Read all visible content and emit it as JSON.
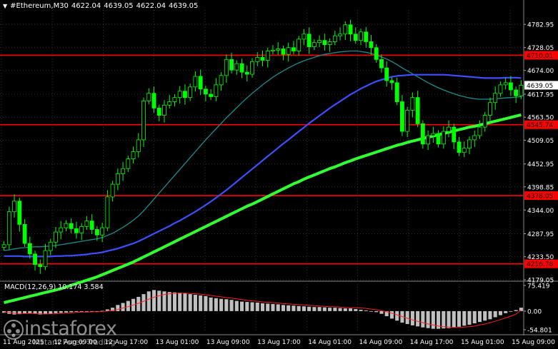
{
  "header": {
    "symbol": "#Ethereum,M30",
    "open": "4622.04",
    "high": "4639.05",
    "low": "4622.04",
    "close": "4639.05"
  },
  "watermark": {
    "brand": "instaforex",
    "tagline": "Instant Forex Trading"
  },
  "colors": {
    "background": "#000000",
    "grid": "#333333",
    "candles": "#00ff00",
    "level_lines": "#ff0000",
    "level_label_bg": "#ff0000",
    "ma_fast": "#1e8c8c",
    "ma_mid": "#3c50ff",
    "ma_slow": "#32ff32",
    "macd_hist": "#c0c0c0",
    "macd_signal": "#ff2020",
    "axis_text": "#ffffff"
  },
  "chart_data": [
    {
      "type": "candlestick",
      "title": "#Ethereum,M30",
      "ylim": [
        4179.05,
        4817.0
      ],
      "y_ticks": [
        "4782.95",
        "4728.05",
        "4674.00",
        "4617.95",
        "4563.50",
        "4509.05",
        "4452.95",
        "4398.85",
        "4344.00",
        "4287.95",
        "4233.50",
        "4179.05"
      ],
      "current_price": "4639.05",
      "x_tick_labels": [
        "11 Aug 2025",
        "12 Aug 09:00",
        "12 Aug 17:00",
        "13 Aug 01:00",
        "13 Aug 09:00",
        "13 Aug 17:00",
        "14 Aug 01:00",
        "14 Aug 09:00",
        "14 Aug 17:00",
        "15 Aug 01:00",
        "15 Aug 09:00"
      ],
      "levels": [
        {
          "value": 4710.01,
          "label": "4710.01"
        },
        {
          "value": 4545.74,
          "label": "4545.74"
        },
        {
          "value": 4378.05,
          "label": "4378.05"
        },
        {
          "value": 4216.78,
          "label": "4216.78"
        }
      ],
      "series": [
        {
          "role": "close",
          "color": "#00ff00",
          "values": [
            4262,
            4340,
            4365,
            4310,
            4265,
            4240,
            4215,
            4210,
            4248,
            4268,
            4292,
            4302,
            4312,
            4300,
            4290,
            4305,
            4318,
            4298,
            4285,
            4302,
            4375,
            4405,
            4430,
            4442,
            4465,
            4482,
            4510,
            4602,
            4620,
            4585,
            4568,
            4592,
            4600,
            4610,
            4625,
            4610,
            4635,
            4660,
            4630,
            4618,
            4612,
            4640,
            4662,
            4700,
            4675,
            4690,
            4670,
            4665,
            4695,
            4705,
            4698,
            4720,
            4722,
            4725,
            4712,
            4728,
            4720,
            4748,
            4760,
            4730,
            4740,
            4745,
            4735,
            4742,
            4756,
            4760,
            4782,
            4760,
            4745,
            4765,
            4742,
            4728,
            4700,
            4680,
            4650,
            4645,
            4600,
            4530,
            4580,
            4610,
            4548,
            4500,
            4520,
            4525,
            4500,
            4530,
            4540,
            4505,
            4480,
            4490,
            4510,
            4520,
            4540,
            4568,
            4598,
            4620,
            4640,
            4645,
            4628,
            4614,
            4639
          ]
        },
        {
          "role": "ma",
          "color": "#1e8c8c",
          "values": [
            4248,
            4250,
            4252,
            4254,
            4255,
            4256,
            4257,
            4257,
            4258,
            4259,
            4260,
            4262,
            4264,
            4266,
            4268,
            4270,
            4272,
            4274,
            4276,
            4279,
            4284,
            4289,
            4296,
            4303,
            4311,
            4320,
            4330,
            4342,
            4356,
            4370,
            4384,
            4398,
            4412,
            4426,
            4440,
            4454,
            4468,
            4482,
            4496,
            4510,
            4523,
            4536,
            4549,
            4562,
            4574,
            4586,
            4598,
            4609,
            4620,
            4630,
            4640,
            4649,
            4658,
            4666,
            4673,
            4680,
            4686,
            4692,
            4697,
            4701,
            4705,
            4709,
            4712,
            4714,
            4716,
            4718,
            4719,
            4720,
            4720,
            4719,
            4717,
            4714,
            4710,
            4706,
            4701,
            4695,
            4688,
            4680,
            4673,
            4666,
            4659,
            4652,
            4645,
            4639,
            4633,
            4628,
            4623,
            4619,
            4615,
            4612,
            4609,
            4607,
            4606,
            4606,
            4606,
            4607,
            4608,
            4609,
            4610,
            4611,
            4612
          ]
        },
        {
          "role": "ma",
          "color": "#3c50ff",
          "values": [
            4235,
            4235,
            4235,
            4235,
            4234,
            4234,
            4234,
            4234,
            4234,
            4234,
            4235,
            4235,
            4236,
            4236,
            4237,
            4238,
            4239,
            4241,
            4242,
            4244,
            4247,
            4250,
            4253,
            4257,
            4261,
            4265,
            4270,
            4276,
            4282,
            4288,
            4294,
            4300,
            4306,
            4313,
            4319,
            4326,
            4333,
            4340,
            4348,
            4356,
            4364,
            4373,
            4382,
            4391,
            4401,
            4411,
            4421,
            4431,
            4441,
            4451,
            4461,
            4471,
            4481,
            4491,
            4501,
            4510,
            4520,
            4530,
            4539,
            4549,
            4558,
            4567,
            4576,
            4585,
            4593,
            4601,
            4609,
            4617,
            4624,
            4631,
            4637,
            4643,
            4648,
            4652,
            4656,
            4659,
            4661,
            4662,
            4663,
            4664,
            4664,
            4664,
            4664,
            4664,
            4664,
            4664,
            4663,
            4662,
            4661,
            4660,
            4659,
            4658,
            4657,
            4656,
            4656,
            4656,
            4656,
            4657,
            4657,
            4657,
            4656
          ]
        },
        {
          "role": "ma",
          "color": "#32ff32",
          "values": [
            4125,
            4128,
            4131,
            4134,
            4137,
            4140,
            4143,
            4146,
            4149,
            4152,
            4155,
            4158,
            4162,
            4166,
            4170,
            4174,
            4178,
            4182,
            4186,
            4191,
            4196,
            4201,
            4206,
            4211,
            4216,
            4221,
            4227,
            4233,
            4239,
            4245,
            4251,
            4257,
            4263,
            4269,
            4275,
            4281,
            4287,
            4293,
            4299,
            4305,
            4311,
            4317,
            4323,
            4329,
            4335,
            4341,
            4347,
            4353,
            4358,
            4364,
            4370,
            4376,
            4382,
            4388,
            4394,
            4400,
            4406,
            4411,
            4417,
            4422,
            4427,
            4432,
            4437,
            4442,
            4446,
            4451,
            4456,
            4460,
            4465,
            4469,
            4473,
            4477,
            4481,
            4485,
            4489,
            4493,
            4497,
            4500,
            4504,
            4507,
            4510,
            4513,
            4516,
            4519,
            4522,
            4525,
            4528,
            4531,
            4534,
            4537,
            4540,
            4542,
            4545,
            4548,
            4551,
            4554,
            4557,
            4560,
            4563,
            4566,
            4569
          ]
        }
      ]
    },
    {
      "type": "bar",
      "title": "MACD(12,26,9) 10.174 3.584",
      "ylim": [
        -54.801,
        75.419
      ],
      "y_ticks": [
        "75.419",
        "0.00",
        "-54.801"
      ],
      "series": [
        {
          "name": "MACD",
          "color": "#c0c0c0",
          "values": [
            -5,
            -8,
            -10,
            -9,
            -7,
            -6,
            -8,
            -10,
            -9,
            -8,
            -6,
            -5,
            -4,
            -3,
            -2,
            -2,
            -1,
            -2,
            -1,
            1,
            5,
            10,
            18,
            24,
            30,
            36,
            42,
            50,
            58,
            62,
            60,
            58,
            56,
            55,
            54,
            52,
            50,
            48,
            46,
            44,
            40,
            38,
            36,
            35,
            33,
            30,
            28,
            27,
            26,
            25,
            23,
            22,
            21,
            20,
            18,
            17,
            16,
            15,
            14,
            13,
            12,
            12,
            11,
            10,
            10,
            9,
            8,
            8,
            6,
            4,
            2,
            0,
            -3,
            -8,
            -15,
            -22,
            -28,
            -34,
            -38,
            -42,
            -45,
            -48,
            -50,
            -52,
            -52,
            -51,
            -50,
            -48,
            -46,
            -43,
            -40,
            -36,
            -32,
            -28,
            -24,
            -18,
            -12,
            -6,
            -1,
            3,
            10
          ]
        },
        {
          "name": "Signal",
          "color": "#ff2020",
          "values": [
            -3,
            -4,
            -6,
            -7,
            -7,
            -7,
            -7,
            -8,
            -8,
            -8,
            -8,
            -7,
            -6,
            -5,
            -4,
            -3,
            -3,
            -2,
            -2,
            -1,
            0,
            2,
            5,
            9,
            13,
            18,
            23,
            29,
            35,
            41,
            45,
            49,
            51,
            52,
            53,
            53,
            52,
            51,
            50,
            48,
            46,
            44,
            42,
            40,
            38,
            36,
            34,
            32,
            30,
            29,
            27,
            26,
            25,
            24,
            22,
            21,
            20,
            19,
            18,
            17,
            16,
            15,
            14,
            13,
            13,
            12,
            11,
            10,
            10,
            9,
            8,
            6,
            4,
            1,
            -2,
            -6,
            -11,
            -16,
            -21,
            -26,
            -30,
            -34,
            -38,
            -41,
            -44,
            -46,
            -47,
            -48,
            -48,
            -47,
            -46,
            -44,
            -41,
            -38,
            -34,
            -30,
            -25,
            -20,
            -15,
            -9,
            3.584
          ]
        }
      ]
    }
  ]
}
